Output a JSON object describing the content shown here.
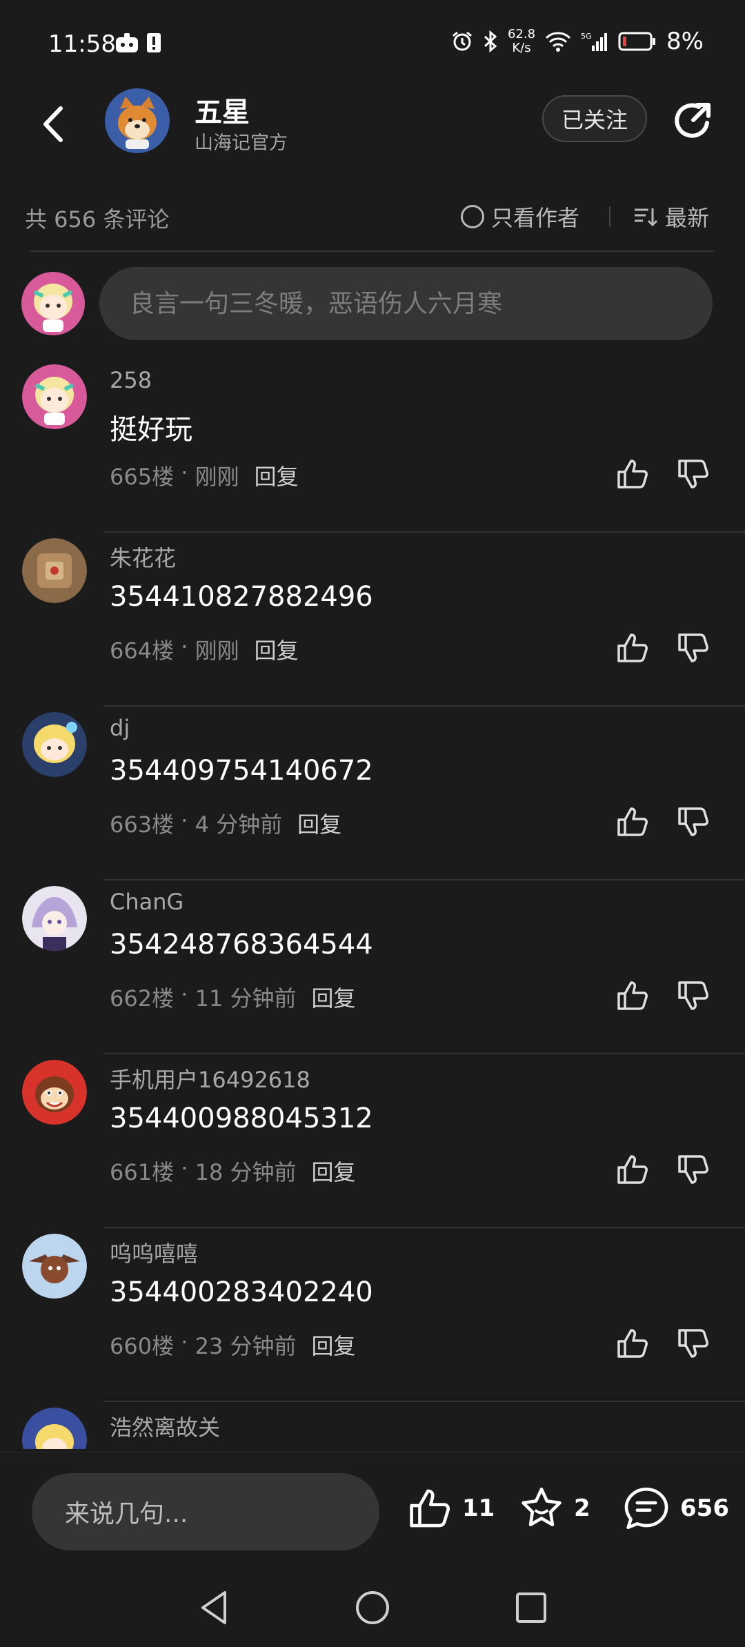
{
  "status": {
    "time": "11:58",
    "net_speed_value": "62.8",
    "net_speed_unit": "K/s",
    "battery": "8%"
  },
  "header": {
    "title": "五星",
    "subtitle": "山海记官方",
    "follow_label": "已关注"
  },
  "filters": {
    "total": "共 656 条评论",
    "author_only": "只看作者",
    "sort": "最新"
  },
  "compose": {
    "placeholder": "良言一句三冬暖，恶语伤人六月寒"
  },
  "comments": [
    {
      "user": "258",
      "text": "挺好玩",
      "floor": "665楼",
      "time": "刚刚",
      "reply": "回复"
    },
    {
      "user": "朱花花",
      "text": "354410827882496",
      "floor": "664楼",
      "time": "刚刚",
      "reply": "回复"
    },
    {
      "user": "dj",
      "text": "354409754140672",
      "floor": "663楼",
      "time": "4 分钟前",
      "reply": "回复"
    },
    {
      "user": "ChanG",
      "text": "354248768364544",
      "floor": "662楼",
      "time": "11 分钟前",
      "reply": "回复"
    },
    {
      "user": "手机用户16492618",
      "text": "354400988045312",
      "floor": "661楼",
      "time": "18 分钟前",
      "reply": "回复"
    },
    {
      "user": "呜呜嘻嘻",
      "text": "354400283402240",
      "floor": "660楼",
      "time": "23 分钟前",
      "reply": "回复"
    },
    {
      "user": "浩然离故关",
      "text": "",
      "floor": "",
      "time": "",
      "reply": ""
    }
  ],
  "bottom": {
    "say_placeholder": "来说几句...",
    "likes": "11",
    "favorites": "2",
    "comments": "656"
  },
  "colors": {
    "background": "#1b1b1b",
    "input_bg": "#353535",
    "divider": "#333333"
  }
}
